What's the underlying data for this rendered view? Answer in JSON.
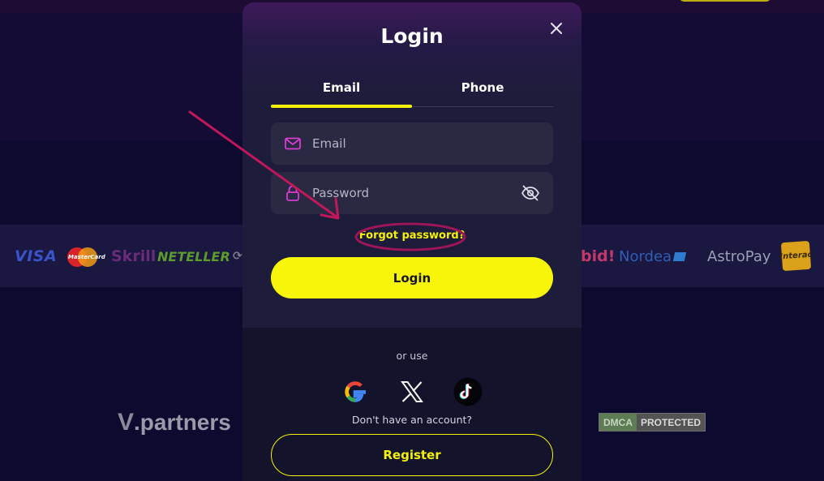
{
  "background": {
    "payment_logos": [
      "VISA",
      "MasterCard",
      "Skrill",
      "NETELLER",
      "bid!",
      "Nordea",
      "AstroPay",
      "Interac"
    ],
    "partner_logo": {
      "v": "V",
      "text": ".partners"
    },
    "dmca": {
      "left": "DMCA",
      "right": "PROTECTED"
    }
  },
  "modal": {
    "title": "Login",
    "close_icon": "close-icon",
    "tabs": [
      {
        "label": "Email",
        "active": true
      },
      {
        "label": "Phone",
        "active": false
      }
    ],
    "email_field": {
      "placeholder": "Email",
      "icon": "mail-icon",
      "value": ""
    },
    "password_field": {
      "placeholder": "Password",
      "icon": "lock-icon",
      "toggle_icon": "eye-off-icon",
      "value": ""
    },
    "forgot_label": "Forgot password?",
    "login_label": "Login",
    "or_use": "or use",
    "social": [
      "google-icon",
      "x-icon",
      "tiktok-icon"
    ],
    "no_account": "Don't have an account?",
    "register_label": "Register"
  },
  "colors": {
    "accent": "#f4f20a",
    "icon_magenta": "#d83bd0",
    "annotation": "#c2185b",
    "modal_bg": "#1d1c3a",
    "page_bg": "#0c0a2e"
  },
  "annotation": {
    "arrow": "pointing-to-forgot-password",
    "circle": "around-forgot-password"
  }
}
